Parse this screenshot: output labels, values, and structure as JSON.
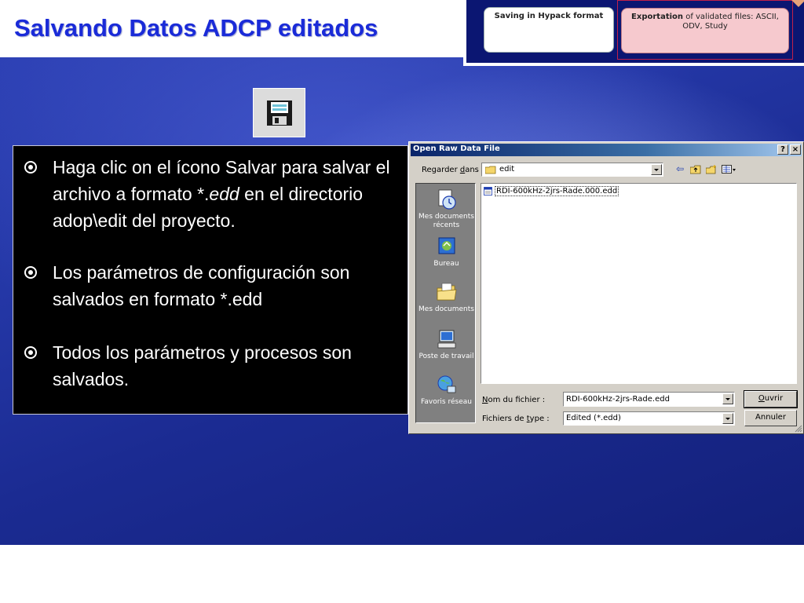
{
  "slide": {
    "title": "Salvando Datos ADCP editados"
  },
  "diagram": {
    "box_hypack": "Saving in Hypack format",
    "box_export_bold": "Exportation",
    "box_export_rest": " of validated files: ASCII, ODV, Study"
  },
  "bullets": [
    {
      "text_before": "Haga clic on el ícono Salvar para salvar el archivo a formato *.",
      "italic": "edd",
      "text_after": " en el directorio adop\\edit del proyecto."
    },
    {
      "text": "Los parámetros de configuración son salvados en formato *.edd"
    },
    {
      "text": "Todos los parámetros y procesos son salvados."
    }
  ],
  "dialog": {
    "title": "Open Raw Data File",
    "help_label": "?",
    "close_label": "×",
    "look_in_label_pre": "Regarder ",
    "look_in_label_u": "d",
    "look_in_label_post": "ans :",
    "look_in_value": "edit",
    "places": [
      {
        "label": "Mes documents récents",
        "icon": "recent-documents-icon"
      },
      {
        "label": "Bureau",
        "icon": "desktop-icon"
      },
      {
        "label": "Mes documents",
        "icon": "my-documents-icon"
      },
      {
        "label": "Poste de travail",
        "icon": "my-computer-icon"
      },
      {
        "label": "Favoris réseau",
        "icon": "network-places-icon"
      }
    ],
    "files": [
      "RDI-600kHz-2jrs-Rade.000.edd"
    ],
    "filename_label_u": "N",
    "filename_label_rest": "om du fichier :",
    "filename_value": "RDI-600kHz-2jrs-Rade.edd",
    "filetype_label_pre": "Fichiers de ",
    "filetype_label_u": "t",
    "filetype_label_post": "ype :",
    "filetype_value": "Edited (*.edd)",
    "open_u": "O",
    "open_rest": "uvrir",
    "cancel_label": "Annuler"
  },
  "colors": {
    "title": "#1a2bd8",
    "titlebar_start": "#0a246a",
    "dialog_face": "#d4d0c8"
  }
}
